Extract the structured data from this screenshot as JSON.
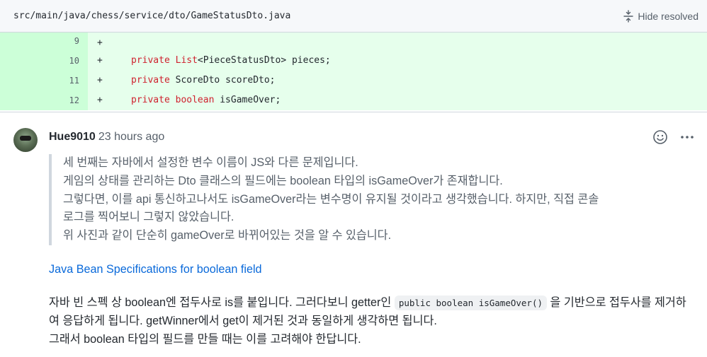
{
  "file": {
    "path": "src/main/java/chess/service/dto/GameStatusDto.java",
    "hide_resolved_label": "Hide resolved"
  },
  "diff_lines": [
    {
      "num": "9",
      "sign": "+",
      "keyword": "",
      "rest": ""
    },
    {
      "num": "10",
      "sign": "+",
      "keyword": "private List",
      "rest": "<PieceStatusDto> pieces;"
    },
    {
      "num": "11",
      "sign": "+",
      "keyword": "private",
      "rest": " ScoreDto scoreDto;"
    },
    {
      "num": "12",
      "sign": "+",
      "keyword": "private boolean",
      "rest": " isGameOver;"
    }
  ],
  "comment": {
    "author": "Hue9010",
    "time": "23 hours ago",
    "quote_lines": [
      "세 번째는 자바에서 설정한 변수 이름이 JS와 다른 문제입니다.",
      "게임의 상태를 관리하는 Dto 클래스의 필드에는 boolean 타입의 isGameOver가 존재합니다.",
      "그렇다면, 이를 api 통신하고나서도 isGameOver라는 변수명이 유지될 것이라고 생각했습니다. 하지만, 직접 콘솔",
      "로그를 찍어보니 그렇지 않았습니다.",
      "위 사진과 같이 단순히 gameOver로 바뀌어있는 것을 알 수 있습니다."
    ],
    "link_text": "Java Bean Specifications for boolean field",
    "body_1": "자바 빈 스펙 상 boolean엔 접두사로 is를 붙입니다. 그러다보니 getter인 ",
    "body_code": "public boolean isGameOver()",
    "body_2": " 을 기반으로 접두사를 제거하여 응답하게 됩니다. getWinner에서 get이 제거된 것과 동일하게 생각하면 됩니다.",
    "body_3": "그래서 boolean 타입의 필드를 만들 때는 이를 고려해야 한답니다."
  }
}
